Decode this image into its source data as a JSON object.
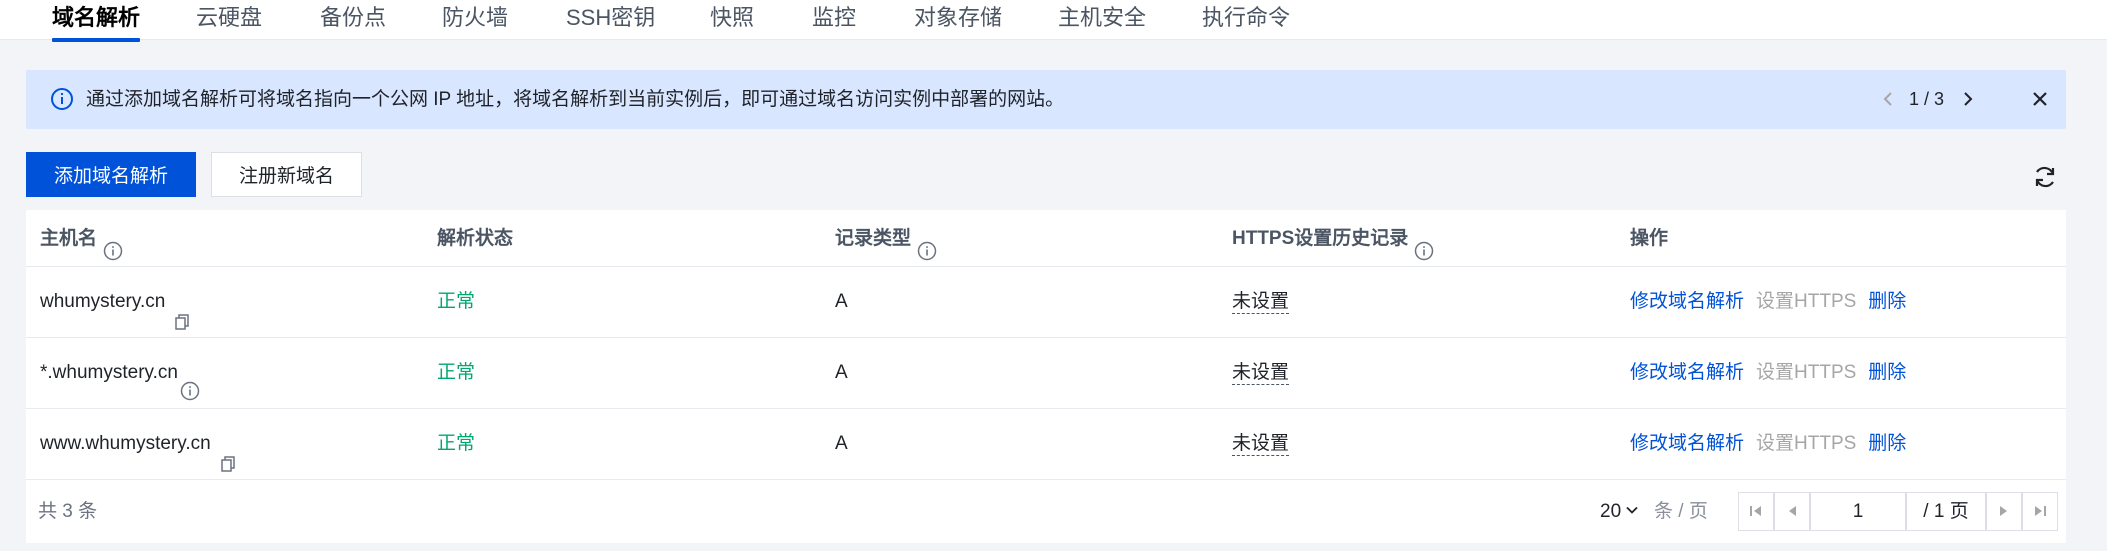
{
  "tabs": [
    {
      "label": "域名解析",
      "active": true
    },
    {
      "label": "云硬盘"
    },
    {
      "label": "备份点"
    },
    {
      "label": "防火墙"
    },
    {
      "label": "SSH密钥"
    },
    {
      "label": "快照"
    },
    {
      "label": "监控"
    },
    {
      "label": "对象存储"
    },
    {
      "label": "主机安全"
    },
    {
      "label": "执行命令"
    }
  ],
  "banner": {
    "message": "通过添加域名解析可将域名指向一个公网 IP 地址，将域名解析到当前实例后，即可通过域名访问实例中部署的网站。",
    "pager": "1 / 3"
  },
  "toolbar": {
    "add_label": "添加域名解析",
    "register_label": "注册新域名"
  },
  "table": {
    "headers": [
      "主机名",
      "解析状态",
      "记录类型",
      "HTTPS设置历史记录",
      "操作"
    ],
    "rows": [
      {
        "host": "whumystery.cn",
        "status": "正常",
        "type": "A",
        "https": "未设置",
        "icon": "copy-icon"
      },
      {
        "host": "*.whumystery.cn",
        "status": "正常",
        "type": "A",
        "https": "未设置",
        "icon": "info-icon"
      },
      {
        "host": "www.whumystery.cn",
        "status": "正常",
        "type": "A",
        "https": "未设置",
        "icon": "copy-icon"
      }
    ],
    "ops": {
      "modify": "修改域名解析",
      "https": "设置HTTPS",
      "delete": "删除"
    }
  },
  "pagination": {
    "total": "共 3 条",
    "page_size": "20",
    "page_size_unit": "条 / 页",
    "current_page": "1",
    "total_pages": "/ 1 页"
  },
  "colors": {
    "primary": "#0052d9",
    "success": "#00a870",
    "banner_bg": "#d9e6ff",
    "disabled": "#a6a6a6"
  }
}
